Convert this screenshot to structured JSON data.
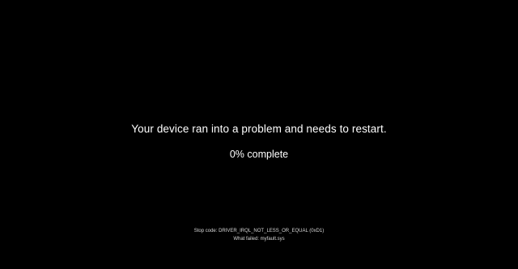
{
  "screen": {
    "background": "#000000",
    "text_color": "#ffffff"
  },
  "message": "Your device ran into a problem and needs to restart.",
  "progress": {
    "value": 0,
    "text": "0% complete"
  },
  "footer": {
    "stop_code": "Stop code: DRIVER_IRQL_NOT_LESS_OR_EQUAL (0xD1)",
    "what_failed": "What failed: myfault.sys"
  }
}
